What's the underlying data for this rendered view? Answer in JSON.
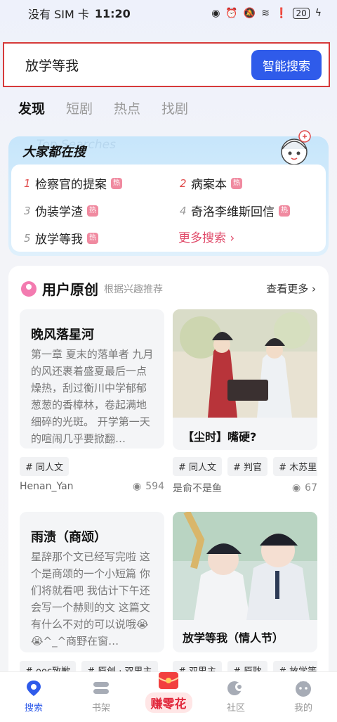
{
  "status_bar": {
    "carrier": "没有 SIM 卡",
    "time": "11:20",
    "battery": "20"
  },
  "search": {
    "query": "放学等我",
    "button_label": "智能搜索"
  },
  "tabs": [
    {
      "label": "发现",
      "active": true
    },
    {
      "label": "短剧",
      "active": false
    },
    {
      "label": "热点",
      "active": false
    },
    {
      "label": "找剧",
      "active": false
    }
  ],
  "hot": {
    "title": "大家都在搜",
    "bg_text": "Top Searches",
    "badge": "热",
    "more_label": "更多搜索 ›",
    "items": [
      {
        "rank": "1",
        "label": "检察官的提案"
      },
      {
        "rank": "2",
        "label": "病案本"
      },
      {
        "rank": "3",
        "label": "伪装学渣"
      },
      {
        "rank": "4",
        "label": "奇洛李维斯回信"
      },
      {
        "rank": "5",
        "label": "放学等我"
      }
    ]
  },
  "section": {
    "title": "用户原创",
    "subtitle": "根据兴趣推荐",
    "more_label": "查看更多 ›"
  },
  "cards": [
    {
      "title": "晚风落星河",
      "excerpt": "第一章 夏末的落单者 九月的风还裹着盛夏最后一点燥热，刮过衡川中学郁郁葱葱的香樟林，卷起满地细碎的光斑。 开学第一天的喧闹几乎要掀翻…",
      "tags": [
        "# 同人文"
      ],
      "author": "Henan_Yan",
      "views": "594"
    },
    {
      "title": "【尘时】嘴硬?",
      "tags": [
        "# 同人文",
        "# 判官",
        "# 木苏里"
      ],
      "author": "是俞不是鱼",
      "views": "67"
    },
    {
      "title": "雨渍（商颂）",
      "excerpt": "星辞那个文已经写完啦 这个是商颂的一个小短篇 你们将就看吧 我估计下午还会写一个赫则的文 这篇文有什么不对的可以说哦😭😭^_^商野在窗…",
      "tags": [
        "# ooc致歉",
        "# 原创 · 双男主"
      ]
    },
    {
      "title": "放学等我（情人节）",
      "tags": [
        "# 双男主",
        "# 原耽",
        "# 放学等我"
      ]
    }
  ],
  "nav": [
    {
      "label": "搜索",
      "active": true
    },
    {
      "label": "书架",
      "active": false
    },
    {
      "label": "赚零花",
      "active": false
    },
    {
      "label": "社区",
      "active": false
    },
    {
      "label": "我的",
      "active": false
    }
  ],
  "colors": {
    "accent": "#2f5bea",
    "hot_rank": "#e04b4b",
    "badge": "#f08aa0",
    "highlight_border": "#d63a3a"
  }
}
